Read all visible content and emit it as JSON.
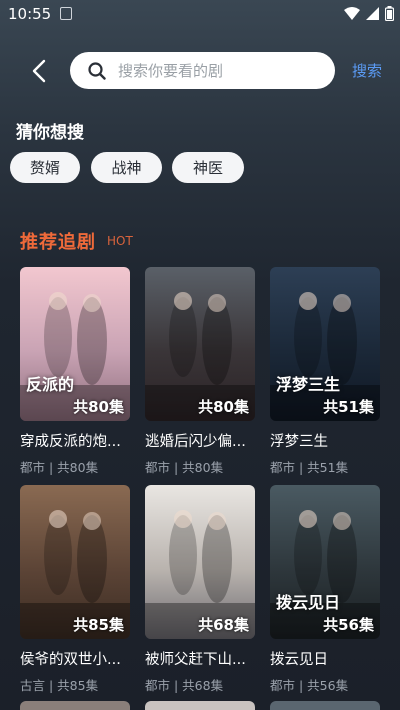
{
  "status": {
    "time": "10:55"
  },
  "search": {
    "placeholder": "搜索你要看的剧",
    "submit_label": "搜索"
  },
  "guess": {
    "title": "猜你想搜",
    "chips": [
      "赘婿",
      "战神",
      "神医"
    ]
  },
  "recommend": {
    "title": "推荐追剧",
    "tag": "HOT",
    "items": [
      {
        "title": "穿成反派的炮...",
        "genre": "都市",
        "episodes": "共80集",
        "meta": "都市 | 共80集",
        "poster_text": "反派的",
        "colors": [
          "#f2c7cf",
          "#c9a3b4",
          "#8d6d7c"
        ]
      },
      {
        "title": "逃婚后闪少偏...",
        "genre": "都市",
        "episodes": "共80集",
        "meta": "都市 | 共80集",
        "poster_text": "",
        "colors": [
          "#5a6068",
          "#3a3538",
          "#2a2225"
        ]
      },
      {
        "title": "浮梦三生",
        "genre": "都市",
        "episodes": "共51集",
        "meta": "都市 | 共51集",
        "poster_text": "浮梦三生",
        "colors": [
          "#2d3f55",
          "#1b2838",
          "#0f1723"
        ]
      },
      {
        "title": "侯爷的双世小...",
        "genre": "古言",
        "episodes": "共85集",
        "meta": "古言 | 共85集",
        "poster_text": "",
        "colors": [
          "#8a6a52",
          "#5c4436",
          "#3a2b22"
        ]
      },
      {
        "title": "被师父赶下山...",
        "genre": "都市",
        "episodes": "共68集",
        "meta": "都市 | 共68集",
        "poster_text": "",
        "colors": [
          "#e9e6e2",
          "#b9b3ae",
          "#6c6a70"
        ]
      },
      {
        "title": "拨云见日",
        "genre": "都市",
        "episodes": "共56集",
        "meta": "都市 | 共56集",
        "poster_text": "拨云见日",
        "colors": [
          "#4a5a62",
          "#2e373c",
          "#1a1f22"
        ]
      }
    ]
  },
  "colors": {
    "accent_blue": "#5b9bf5",
    "hot_orange": "#ef6a3a"
  }
}
